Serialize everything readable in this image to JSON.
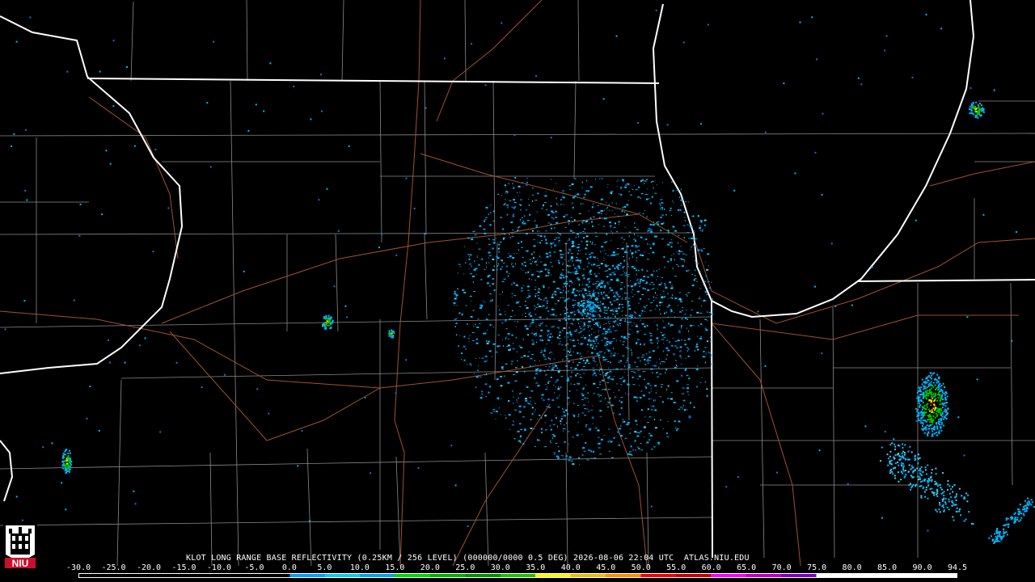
{
  "caption": "KLOT LONG RANGE BASE REFLECTIVITY (0.25KM / 256 LEVEL) (000000/0000 0.5 DEG) 2026-08-06 22:04 UTC  ATLAS.NIU.EDU",
  "logo": {
    "text": "NIU",
    "color": "#c8102e"
  },
  "colorscale": {
    "labels": [
      "-30.0",
      "-25.0",
      "-20.0",
      "-15.0",
      "-10.0",
      "-5.0",
      "0.0",
      "5.0",
      "10.0",
      "15.0",
      "20.0",
      "25.0",
      "30.0",
      "35.0",
      "40.0",
      "45.0",
      "50.0",
      "55.0",
      "60.0",
      "65.0",
      "70.0",
      "75.0",
      "80.0",
      "85.0",
      "90.0",
      "94.5"
    ],
    "colors": [
      "#000000",
      "#000000",
      "#000000",
      "#000000",
      "#000000",
      "#000000",
      "#02a0f6",
      "#02d2e8",
      "#01a3e0",
      "#00d800",
      "#00b000",
      "#009000",
      "#20c000",
      "#f8f800",
      "#e8c000",
      "#f89000",
      "#f80000",
      "#c80000",
      "#ff00ff",
      "#c000c0",
      "#8000c0",
      "#ffffff",
      "#ffffff",
      "#ffffff",
      "#ffffff"
    ]
  },
  "map": {
    "state_border_color": "#ffffff",
    "county_line_color": "#8a8a8a",
    "highway_color": "#a0522d",
    "echo_colors": [
      "#00b7ff",
      "#0a78d8",
      "#3fd0f0",
      "#00c800",
      "#f0e000",
      "#e03000"
    ]
  }
}
